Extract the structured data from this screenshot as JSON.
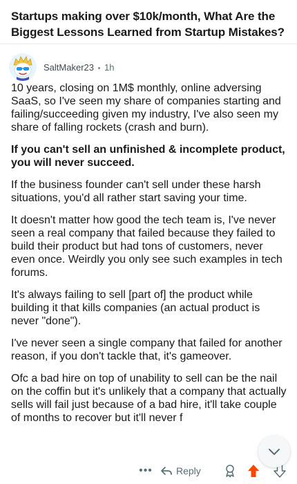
{
  "post": {
    "title": "Startups making over $10k/month, What Are the Biggest Lessons Learned from Startup Mistakes?"
  },
  "comment": {
    "author": "SaltMaker23",
    "age": "1h",
    "paragraphs": [
      "10 years, closing on 1M$ monthly, online adversing SaaS, so I've seen my share of companies starting and failing/succeeding given my industry, I've also seen my share of falling rockets (crash and burn).",
      "If you can't sell an unfinished & incomplete product, you will never succeed.",
      "If the business founder can't sell under these harsh situations, you'd all rather start saving your time.",
      "It doesn't matter how good the tech team is, I've never seen a real company that failed because they failed to build their product but had tons of customers, never even once. Weirdly you only see such examples in tech forums.",
      "It's always failing to sell [part of] the product while building it that kills companies (an actual product is never \"done\").",
      "I've never seen a single company that failed for another reason, if you don't tackle that, it's gameover.",
      "Ofc a bad hire on top of unability to sell can be the nail on the coffin but it's unlikely that a company that actually sells will fail just because of a bad hire, it'll take couple of months to recover but it'll never f"
    ]
  },
  "actions": {
    "more_label": "•••",
    "reply_label": "Reply"
  },
  "icons": {
    "more": "more-dots-icon",
    "reply": "reply-arrow-icon",
    "award": "award-icon",
    "upvote": "upvote-arrow-icon",
    "downvote": "downvote-arrow-icon",
    "collapse": "chevron-down-icon",
    "avatar": "snoo-avatar-icon"
  },
  "colors": {
    "upvote": "#ff4500",
    "meta_text": "#576f76",
    "text": "#1a1a1b"
  }
}
